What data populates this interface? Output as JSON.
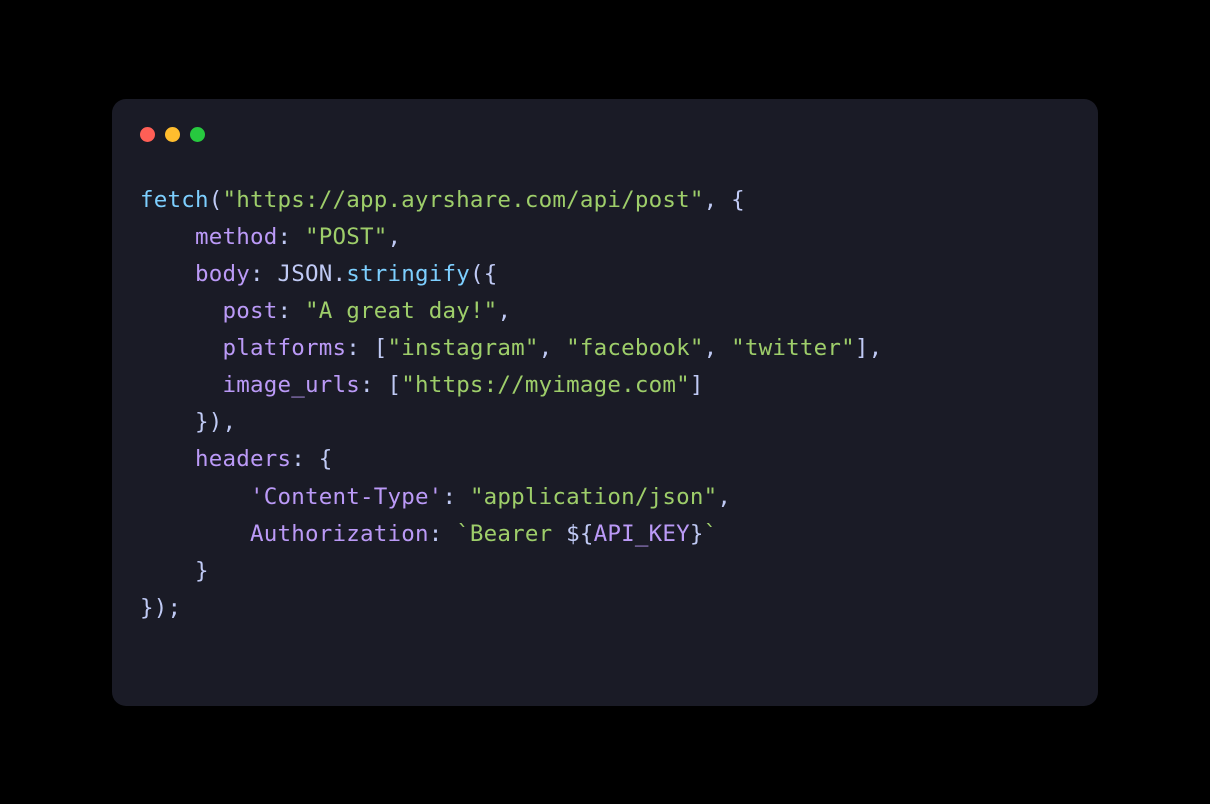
{
  "colors": {
    "background": "#1a1b26",
    "traffic_red": "#ff5f56",
    "traffic_yellow": "#ffbd2e",
    "traffic_green": "#27c93f",
    "fn": "#7dcfff",
    "string": "#9ece6a",
    "key": "#bb9af7",
    "punct": "#c0caf5"
  },
  "code": {
    "fn_name": "fetch",
    "url": "\"https://app.ayrshare.com/api/post\"",
    "comma_open": ", {",
    "indent1": "    ",
    "indent2": "      ",
    "indent3": "        ",
    "method_key": "method",
    "colon_space": ": ",
    "method_val": "\"POST\"",
    "comma": ",",
    "body_key": "body",
    "json_obj": "JSON",
    "dot": ".",
    "stringify": "stringify",
    "paren_brace_open": "({",
    "post_key": "post",
    "post_val": "\"A great day!\"",
    "platforms_key": "platforms",
    "arr_open": "[",
    "platform1": "\"instagram\"",
    "platform2": "\"facebook\"",
    "platform3": "\"twitter\"",
    "arr_close": "]",
    "imgurls_key": "image_urls",
    "imgurl_val": "\"https://myimage.com\"",
    "brace_paren_close": "}),",
    "headers_key": "headers",
    "brace_open": "{",
    "ct_key": "'Content-Type'",
    "ct_val": "\"application/json\"",
    "auth_key": "Authorization",
    "tmpl_open": "`Bearer ",
    "tmpl_interp_open": "${",
    "api_key": "API_KEY",
    "tmpl_interp_close": "}",
    "tmpl_close": "`",
    "brace_close": "}",
    "final_close": "});"
  }
}
